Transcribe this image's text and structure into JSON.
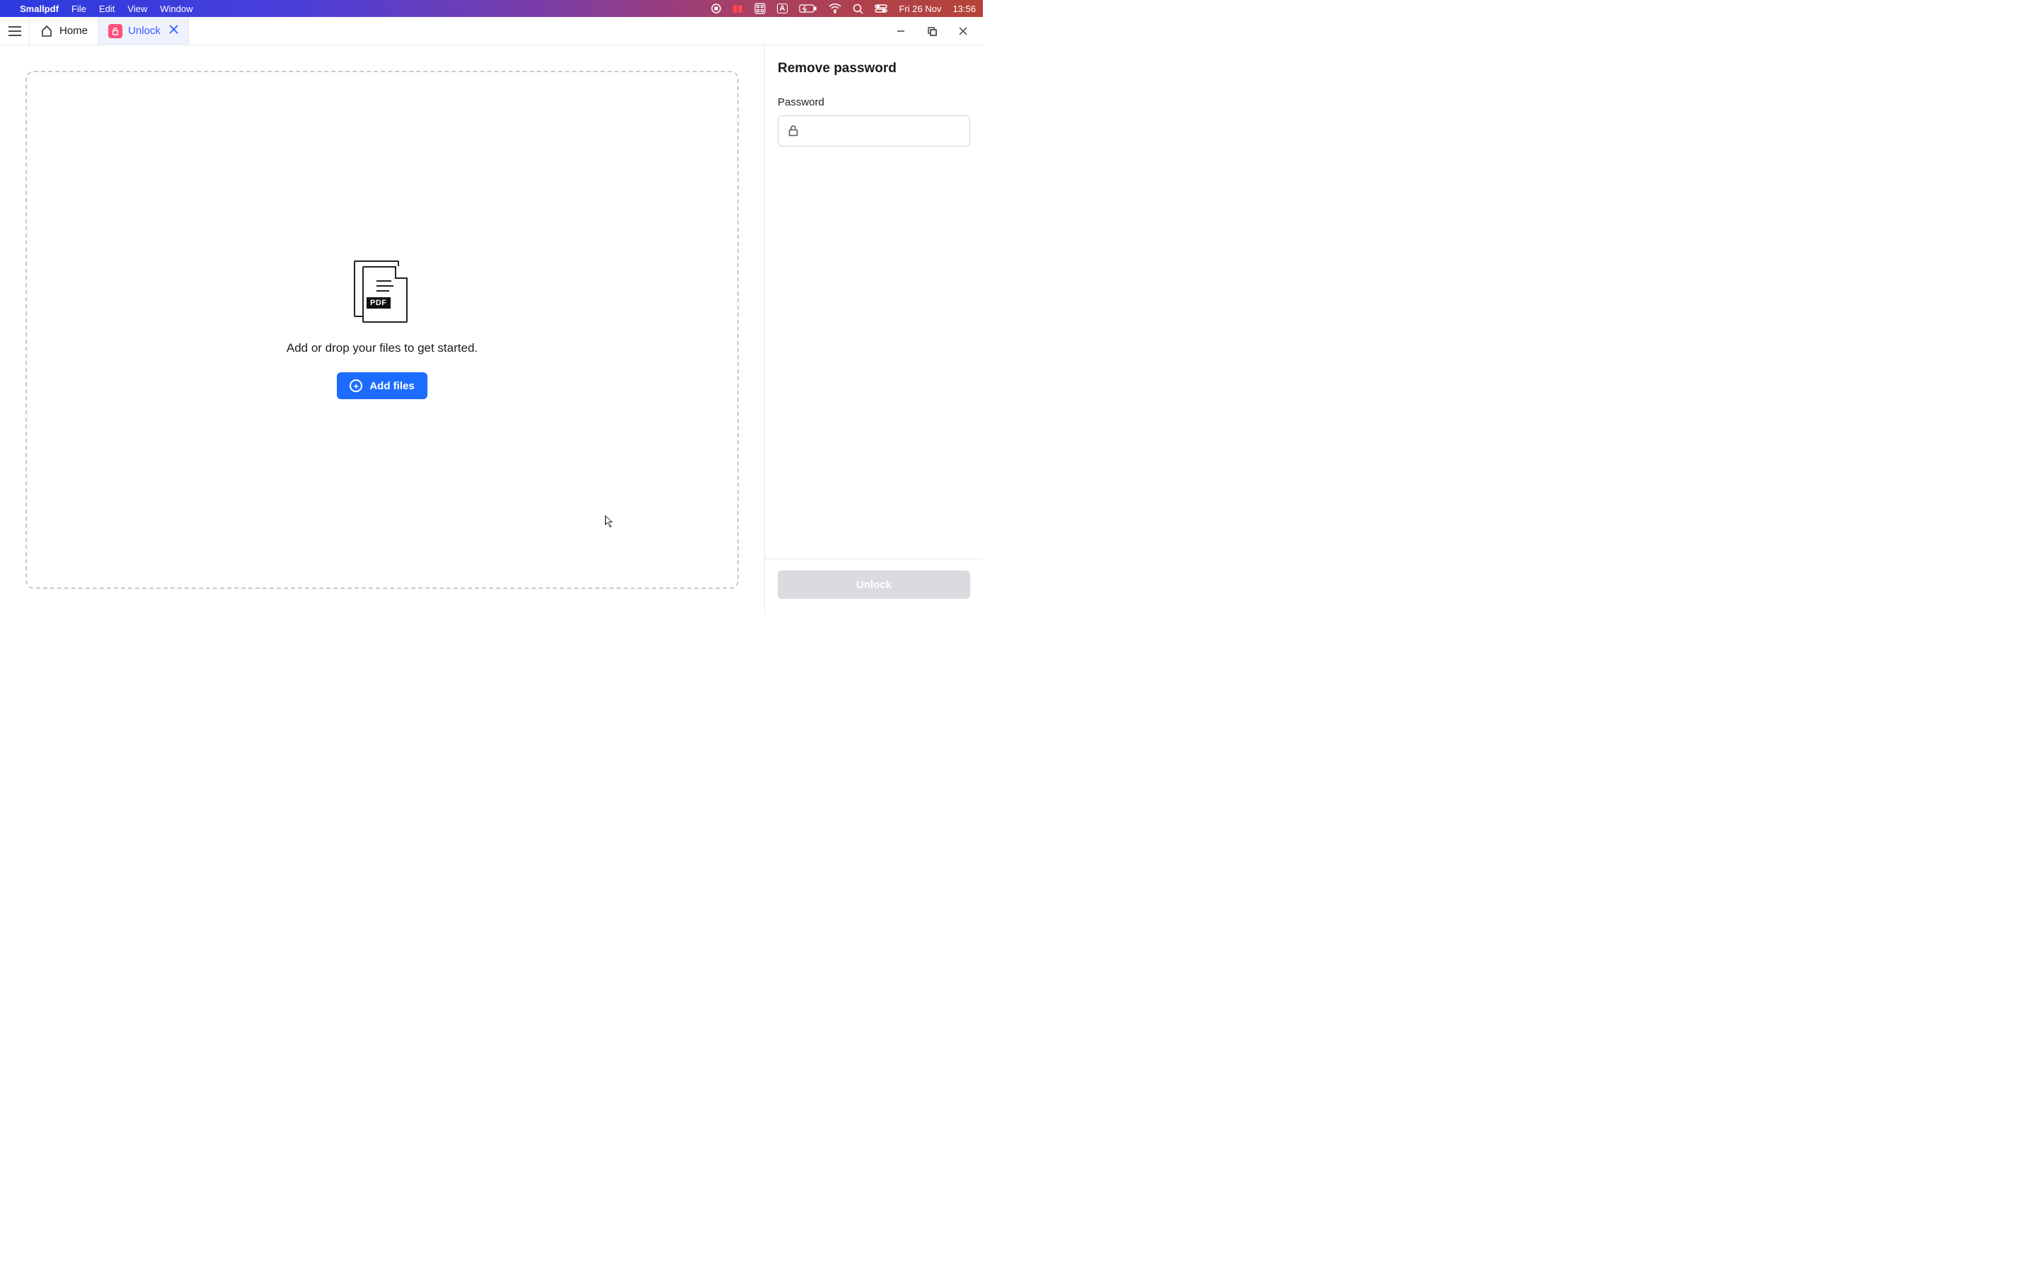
{
  "menubar": {
    "app_name": "Smallpdf",
    "items": [
      "File",
      "Edit",
      "View",
      "Window"
    ],
    "date": "Fri 26 Nov",
    "time": "13:56"
  },
  "tabs": {
    "home_label": "Home",
    "unlock_label": "Unlock"
  },
  "dropzone": {
    "message": "Add or drop your files to get started.",
    "button_label": "Add files",
    "pdf_badge": "PDF"
  },
  "sidebar": {
    "title": "Remove password",
    "password_label": "Password",
    "password_value": "",
    "unlock_button": "Unlock"
  }
}
